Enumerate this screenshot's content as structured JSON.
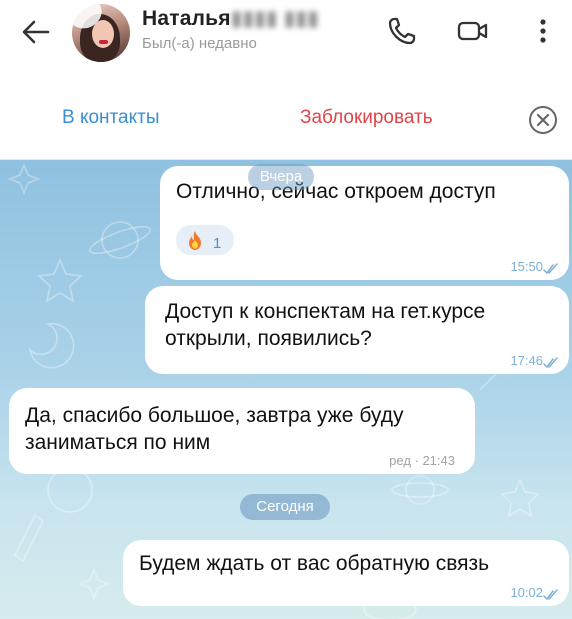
{
  "header": {
    "contact_name": "Наталья",
    "status_text": "Был(-а) недавно"
  },
  "actions": {
    "add_contact": "В контакты",
    "block": "Заблокировать"
  },
  "messages": [
    {
      "direction": "outgoing",
      "text": "Отлично, сейчас откроем доступ",
      "time": "15:50",
      "reaction": {
        "emoji": "fire",
        "count": "1"
      }
    },
    {
      "direction": "outgoing",
      "text_lines": [
        "Доступ к конспектам на гет.курсе",
        "открыли, появились?"
      ],
      "time": "17:46"
    },
    {
      "direction": "incoming",
      "text_lines": [
        "Да, спасибо большое, завтра уже буду",
        "заниматься по ним"
      ],
      "time": "ред · 21:43"
    },
    {
      "direction": "outgoing",
      "text": "Будем ждать от вас обратную связь",
      "time": "10:02"
    }
  ],
  "date_separators": {
    "yesterday": "Вчера",
    "today": "Сегодня"
  },
  "colors": {
    "accent_blue": "#3a8ed6",
    "block_red": "#e0454a",
    "chat_bg": "#a9d2e8",
    "read_ticks": "#7fb0d3"
  }
}
